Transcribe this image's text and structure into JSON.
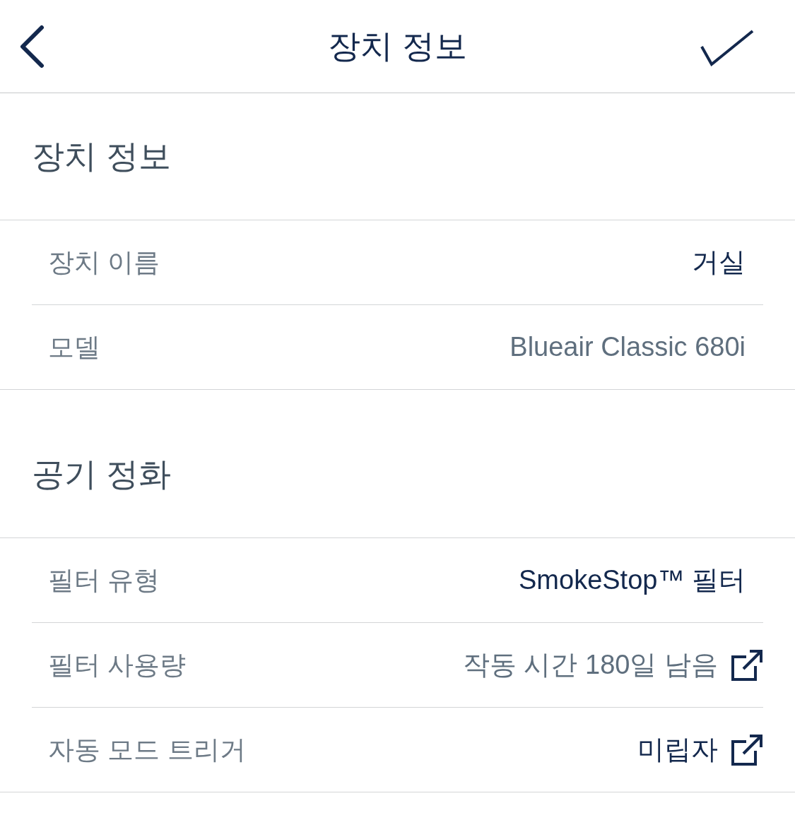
{
  "header": {
    "title": "장치 정보"
  },
  "sections": [
    {
      "title": "장치 정보",
      "rows": [
        {
          "label": "장치 이름",
          "value": "거실",
          "editable": true,
          "external_link": false
        },
        {
          "label": "모델",
          "value": "Blueair Classic 680i",
          "editable": false,
          "external_link": false
        }
      ]
    },
    {
      "title": "공기 정화",
      "rows": [
        {
          "label": "필터 유형",
          "value": "SmokeStop™ 필터",
          "editable": true,
          "external_link": false
        },
        {
          "label": "필터 사용량",
          "value": "작동 시간 180일 남음",
          "editable": false,
          "external_link": true
        },
        {
          "label": "자동 모드 트리거",
          "value": "미립자",
          "editable": true,
          "external_link": true
        }
      ]
    }
  ]
}
